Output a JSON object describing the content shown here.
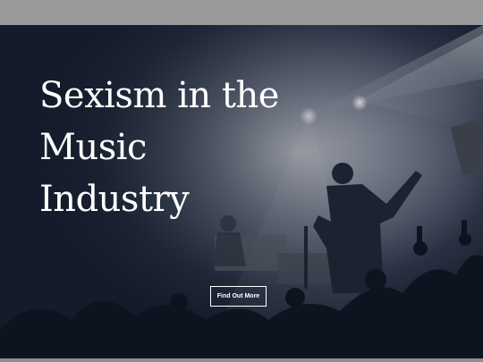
{
  "hero": {
    "title_lines": [
      "Sexism in the",
      "Music",
      "Industry"
    ],
    "cta_label": "Find Out More"
  },
  "colors": {
    "overlay": "#141c2b",
    "text": "#ffffff",
    "frame": "#999999"
  }
}
